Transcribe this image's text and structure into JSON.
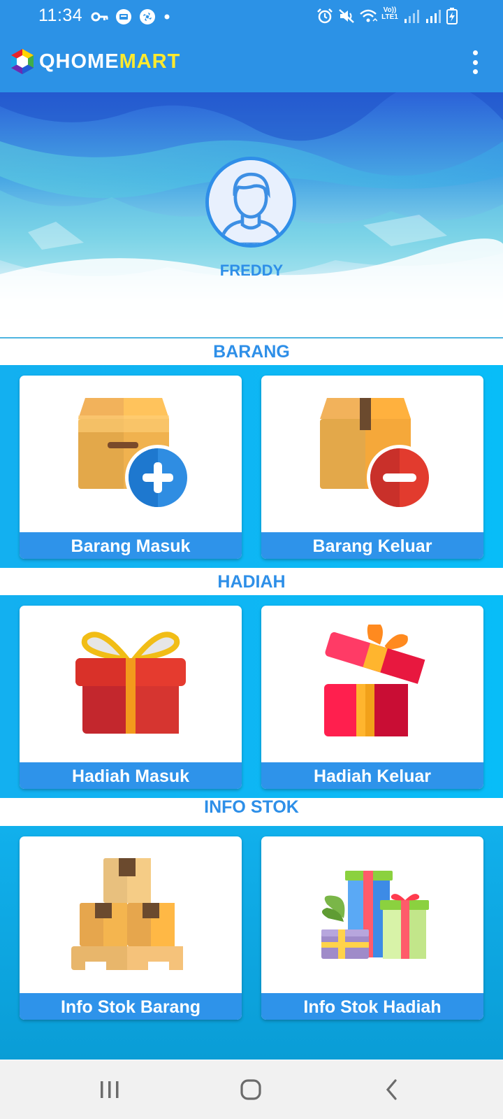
{
  "status_bar": {
    "time": "11:34",
    "volte_label": "Vo)) LTE1",
    "left_icons": [
      "key-icon",
      "chat-bubble-icon",
      "shutter-icon",
      "dot-icon"
    ],
    "right_icons": [
      "alarm-icon",
      "mute-icon",
      "wifi-icon",
      "volte-icon",
      "signal-icon",
      "signal-icon",
      "battery-charging-icon"
    ]
  },
  "app_bar": {
    "logo_home": "QHOME",
    "logo_mart": "MART",
    "menu_icon": "more-vert-icon"
  },
  "profile": {
    "name": "FREDDY",
    "avatar_icon": "user-avatar-icon"
  },
  "sections": {
    "barang": {
      "title": "BARANG",
      "items": [
        {
          "label": "Barang Masuk",
          "icon": "box-add-icon"
        },
        {
          "label": "Barang Keluar",
          "icon": "box-remove-icon"
        }
      ]
    },
    "hadiah": {
      "title": "HADIAH",
      "items": [
        {
          "label": "Hadiah Masuk",
          "icon": "gift-closed-icon"
        },
        {
          "label": "Hadiah Keluar",
          "icon": "gift-open-icon"
        }
      ]
    },
    "info_stok": {
      "title": "INFO STOK",
      "items": [
        {
          "label": "Info Stok Barang",
          "icon": "boxes-pallet-icon"
        },
        {
          "label": "Info Stok Hadiah",
          "icon": "gift-stack-icon"
        }
      ]
    }
  },
  "nav_bar": {
    "items": [
      "recent-apps-icon",
      "home-icon",
      "back-icon"
    ]
  },
  "colors": {
    "primary": "#2c92e6",
    "band": "#0fb5f4",
    "logo_accent": "#ffea2e",
    "label_text": "#ffffff"
  }
}
